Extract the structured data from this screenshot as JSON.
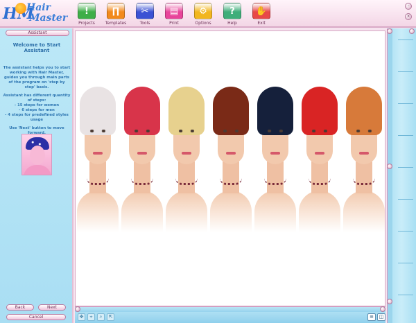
{
  "app": {
    "logo_line1": "Hair",
    "logo_line2": "Master",
    "logo_mark": "HM"
  },
  "toolbar": {
    "items": [
      {
        "label": "Projects",
        "icon": "exclamation-icon",
        "glyph": "!",
        "color": "#3fae48"
      },
      {
        "label": "Templates",
        "icon": "templates-icon",
        "glyph": "∏",
        "color": "#f28a1c"
      },
      {
        "label": "Tools",
        "icon": "scissors-icon",
        "glyph": "✂",
        "color": "#3b52d4"
      },
      {
        "label": "Print",
        "icon": "printer-icon",
        "glyph": "▤",
        "color": "#e8449a"
      },
      {
        "label": "Options",
        "icon": "gear-icon",
        "glyph": "⚙",
        "color": "#f2b61f"
      },
      {
        "label": "Help",
        "icon": "question-icon",
        "glyph": "?",
        "color": "#3fae7a"
      },
      {
        "label": "Exit",
        "icon": "exit-hand-icon",
        "glyph": "✋",
        "color": "#e84848"
      }
    ]
  },
  "window": {
    "minimize_glyph": "–",
    "close_glyph": "×"
  },
  "assistant": {
    "title": "Assistant",
    "welcome": "Welcome to Start Assistant",
    "paragraphs": [
      "The assistant helps you to start working with Hair Master, guides you through main parts of the program on 'step by step' basis.",
      "Assistant has different quantity of steps:",
      "- 15 steps for women",
      "- 6 steps for men",
      "- 4 steps for predefined styles usage",
      "Use 'Next' button to move forward."
    ],
    "back_label": "Back",
    "next_label": "Next",
    "cancel_label": "Cancel"
  },
  "canvas": {
    "faces": [
      {
        "name": "platinum-bob",
        "hair_color": "#e9e3e4"
      },
      {
        "name": "red-bandana",
        "hair_color": "#d8344a"
      },
      {
        "name": "blonde-curls",
        "hair_color": "#e7d18e"
      },
      {
        "name": "auburn-short",
        "hair_color": "#7a2a17"
      },
      {
        "name": "black-bob",
        "hair_color": "#15203b"
      },
      {
        "name": "red-cap",
        "hair_color": "#d92424"
      },
      {
        "name": "copper-spiky",
        "hair_color": "#d77a3a"
      }
    ]
  },
  "bottom_tools": {
    "move": "✥",
    "zoom_fit": "⌖",
    "zoom": "⌕",
    "zoom_out": "⇱",
    "view_list": "≡",
    "view_split": "◫"
  }
}
